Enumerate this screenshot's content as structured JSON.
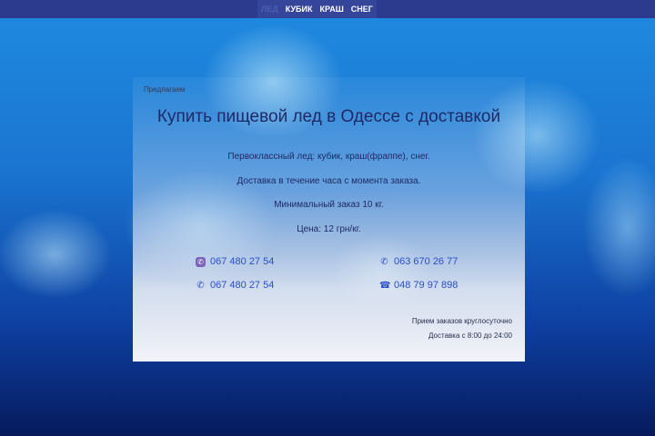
{
  "nav": {
    "items": [
      "ЛЕД",
      "КУБИК",
      "КРАШ",
      "СНЕГ"
    ]
  },
  "panel": {
    "intro": "Предлагаем",
    "title": "Купить пищевой лед в Одессе с доставкой",
    "lines": [
      "Первоклассный лед: кубик, краш(фраппе), снег.",
      "Доставка в течение часа с момента заказа.",
      "Минимальный заказ 10 кг.",
      "Цена: 12 грн/кг."
    ],
    "phones": [
      {
        "icon": "viber-icon",
        "number": "067 480 27 54"
      },
      {
        "icon": "phone-icon",
        "number": "063 670 26 77"
      },
      {
        "icon": "phone-icon",
        "number": "067 480 27 54"
      },
      {
        "icon": "telephone-icon",
        "number": "048 79 97 898"
      }
    ],
    "hours": "Прием заказов круглосуточно",
    "delivery": "Доставка с 8:00 до 24:00"
  }
}
